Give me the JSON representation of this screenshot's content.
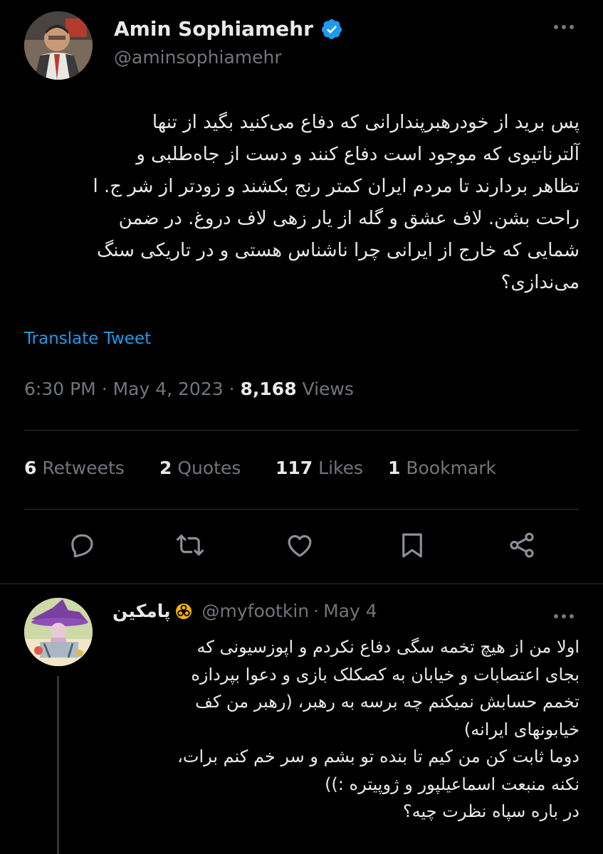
{
  "tweet": {
    "author_name": "Amin Sophiamehr",
    "author_handle": "@aminsophiamehr",
    "text": "پس برید از خودرهبرپندارانی که دفاع می‌کنید بگید از تنها\nآلترناتیوی که موجود است دفاع کنند و دست از جاه‌طلبی و\nتظاهر بردارند تا مردم ایران کمتر رنج بکشند و زودتر از شر ج. ا\nراحت بشن. لاف عشق و گله از یار زهی لاف دروغ. در ضمن\nشمایی که خارج از ایرانی چرا ناشناس هستی و در تاریکی سنگ\nمی‌ندازی؟",
    "translate_label": "Translate Tweet",
    "time": "6:30 PM",
    "dot1": "·",
    "date": "May 4, 2023",
    "dot2": "·",
    "views_count": "8,168",
    "views_label": "Views"
  },
  "stats": {
    "retweets_count": "6",
    "retweets_label": "Retweets",
    "quotes_count": "2",
    "quotes_label": "Quotes",
    "likes_count": "117",
    "likes_label": "Likes",
    "bookmarks_count": "1",
    "bookmarks_label": "Bookmark"
  },
  "actions": [
    "reply-icon",
    "retweet-icon",
    "like-icon",
    "bookmark-icon",
    "share-icon"
  ],
  "reply": {
    "name": "پامکین",
    "handle": "@myfootkin",
    "sep": "·",
    "date": "May 4",
    "text": "اولا من از هیچ تخمه سگی  دفاع نکردم و اپوزسیونی که\nبجای اعتصابات و خیابان به کصکلک بازی و دعوا بپردازه\nتخمم حسابش نمیکنم چه برسه به رهبر، (رهبر من کف\nخیابونهای ایرانه)\nدوما ثابت کن من کیم تا بنده تو بشم و سر خم کنم برات،\nنکنه منبعت اسماعیلپور و ژوپیتره :))\nدر باره سپاه نظرت چیه؟"
  },
  "colors": {
    "background": "#000000",
    "text": "#e7e9ea",
    "muted": "#71767b",
    "accent": "#1d9bf0",
    "divider": "#2f3336"
  }
}
